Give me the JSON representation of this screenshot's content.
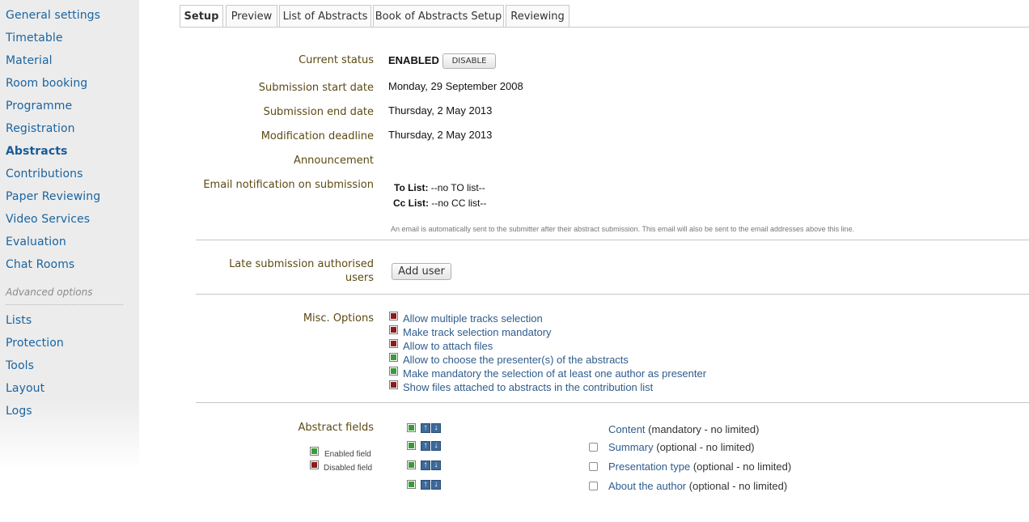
{
  "sidebar": {
    "items": [
      {
        "label": "General settings"
      },
      {
        "label": "Timetable"
      },
      {
        "label": "Material"
      },
      {
        "label": "Room booking"
      },
      {
        "label": "Programme"
      },
      {
        "label": "Registration"
      },
      {
        "label": "Abstracts"
      },
      {
        "label": "Contributions"
      },
      {
        "label": "Paper Reviewing"
      },
      {
        "label": "Video Services"
      },
      {
        "label": "Evaluation"
      },
      {
        "label": "Chat Rooms"
      }
    ],
    "advanced_label": "Advanced options",
    "advanced_items": [
      {
        "label": "Lists"
      },
      {
        "label": "Protection"
      },
      {
        "label": "Tools"
      },
      {
        "label": "Layout"
      },
      {
        "label": "Logs"
      }
    ]
  },
  "tabs": [
    {
      "label": "Setup"
    },
    {
      "label": "Preview"
    },
    {
      "label": "List of Abstracts"
    },
    {
      "label": "Book of Abstracts Setup"
    },
    {
      "label": "Reviewing"
    }
  ],
  "status": {
    "label": "Current status",
    "value": "ENABLED",
    "button": "DISABLE"
  },
  "dates": {
    "start_label": "Submission start date",
    "start_value": "Monday, 29 September 2008",
    "end_label": "Submission end date",
    "end_value": "Thursday, 2 May 2013",
    "mod_label": "Modification deadline",
    "mod_value": "Thursday, 2 May 2013"
  },
  "announcement_label": "Announcement",
  "email": {
    "label": "Email notification on submission",
    "to_label": "To List:",
    "to_value": "--no TO list--",
    "cc_label": "Cc List:",
    "cc_value": "--no CC list--",
    "note": "An email is automatically sent to the submitter after their abstract submission. This email will also be sent to the email addresses above this line."
  },
  "late": {
    "label_line1": "Late submission authorised",
    "label_line2": "users",
    "button": "Add user"
  },
  "misc": {
    "label": "Misc. Options",
    "options": [
      {
        "label": "Allow multiple tracks selection",
        "enabled": false
      },
      {
        "label": "Make track selection mandatory",
        "enabled": false
      },
      {
        "label": "Allow to attach files",
        "enabled": false
      },
      {
        "label": "Allow to choose the presenter(s) of the abstracts",
        "enabled": true
      },
      {
        "label": "Make mandatory the selection of at least one author as presenter",
        "enabled": true
      },
      {
        "label": "Show files attached to abstracts in the contribution list",
        "enabled": false
      }
    ]
  },
  "abstract_fields": {
    "label": "Abstract fields",
    "legend_enabled": "Enabled field",
    "legend_disabled": "Disabled field",
    "fields": [
      {
        "name": "Content",
        "detail": "(mandatory - no limited)"
      },
      {
        "name": "Summary",
        "detail": "(optional - no limited)"
      },
      {
        "name": "Presentation type",
        "detail": "(optional - no limited)"
      },
      {
        "name": "About the author",
        "detail": "(optional - no limited)"
      }
    ]
  },
  "colors": {
    "enabled": "#3a9a3a",
    "disabled": "#8b1c1c",
    "link": "#1a64a0"
  },
  "icons": [
    "up-arrow-icon",
    "down-arrow-icon",
    "enabled-square-icon",
    "disabled-square-icon"
  ]
}
